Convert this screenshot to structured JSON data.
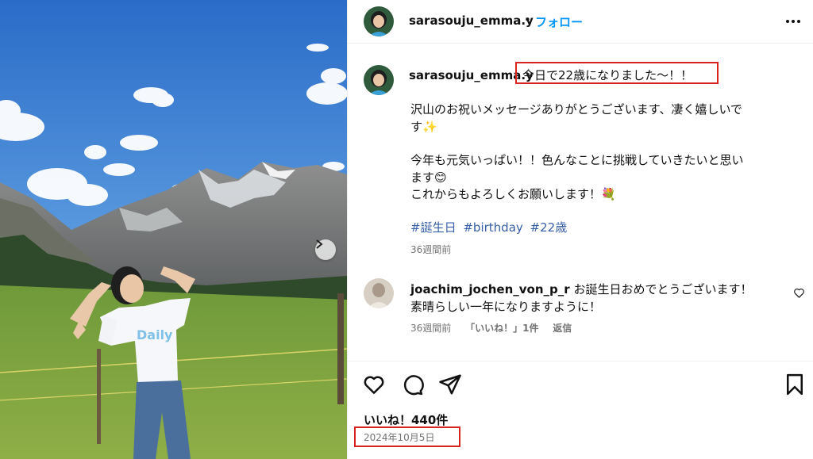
{
  "post": {
    "author": "sarasouju_emma.y",
    "follow_label": "フォロー",
    "separator": "•",
    "more_icon": "more-options-icon"
  },
  "caption": {
    "username": "sarasouju_emma.y",
    "title": "今日で22歳になりました〜！！",
    "lines": [
      "沢山のお祝いメッセージありがとうございます、凄く嬉しいで",
      "す✨",
      "今年も元気いっぱい！！色んなことに挑戦していきたいと思い",
      "ます😊",
      "これからもよろしくお願いします！💐"
    ],
    "hashtags": [
      "#誕生日",
      "#birthday",
      "#22歳"
    ],
    "time": "36週間前"
  },
  "comment": {
    "username": "joachim_jochen_von_p_r",
    "line1": "お誕生日おめでとうございます！",
    "line2": "素晴らしい一年になりますように！",
    "time": "36週間前",
    "likes": "「いいね！」1件",
    "reply": "返信"
  },
  "actions": {
    "icons": [
      "heart-icon",
      "comment-icon",
      "share-icon",
      "bookmark-icon"
    ]
  },
  "likes_label": "いいね！440件",
  "date": "2024年10月5日",
  "colors": {
    "link": "#0095f6",
    "hashtag": "#375fa8",
    "highlight": "#d9231e",
    "muted": "#737373"
  }
}
